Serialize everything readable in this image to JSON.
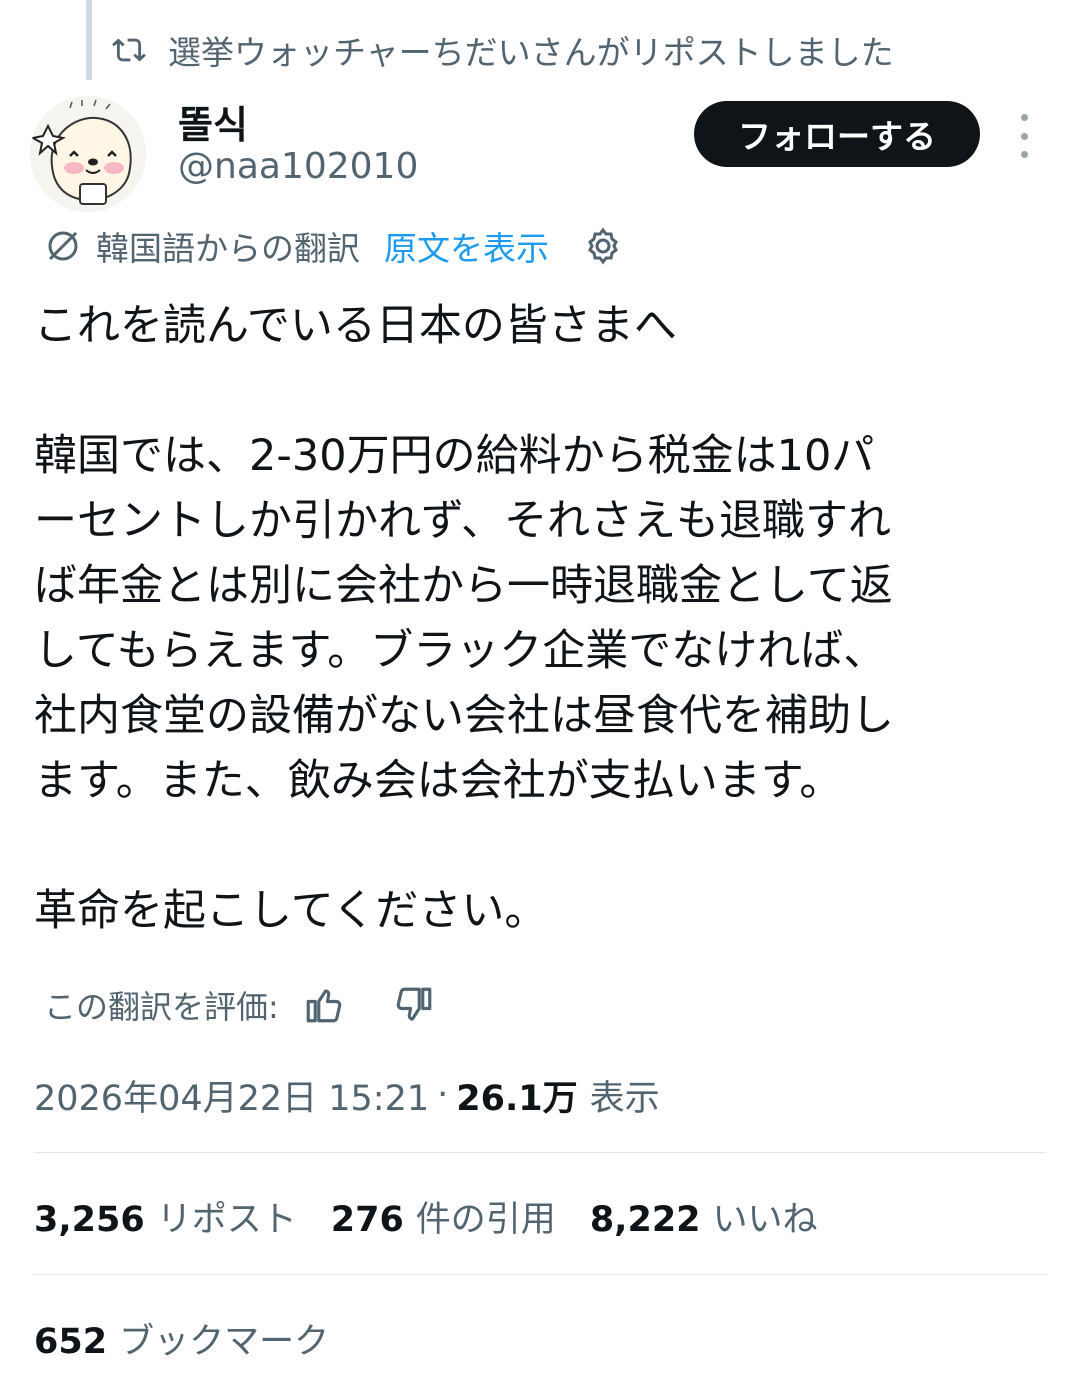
{
  "repost": {
    "icon": "repost-icon",
    "text": "選挙ウォッチャーちだいさんがリポストしました"
  },
  "author": {
    "name": "똘식",
    "handle": "@naa102010"
  },
  "follow_button": {
    "label": "フォローする"
  },
  "translation": {
    "language_label": "韓国語からの翻訳",
    "show_original_label": "原文を表示"
  },
  "tweet": {
    "line1": "これを読んでいる日本の皆さまへ",
    "paragraph2_lines": [
      "韓国では、2-30万円の給料から税金は10パ",
      "ーセントしか引かれず、それさえも退職すれ",
      "ば年金とは別に会社から一時退職金として返",
      "してもらえます。ブラック企業でなければ、",
      "社内食堂の設備がない会社は昼食代を補助し",
      "ます。また、飲み会は会社が支払います。"
    ],
    "line3": "革命を起こしてください。"
  },
  "rating": {
    "label": "この翻訳を評価:"
  },
  "meta": {
    "timestamp": "2026年04月22日 15:21",
    "separator": "·",
    "views_count": "26.1万",
    "views_label": "表示"
  },
  "stats": {
    "reposts": {
      "count": "3,256",
      "label": "リポスト"
    },
    "quotes": {
      "count": "276",
      "label": "件の引用"
    },
    "likes": {
      "count": "8,222",
      "label": "いいね"
    },
    "bookmarks": {
      "count": "652",
      "label": "ブックマーク"
    }
  },
  "colors": {
    "accent": "#1d9bf0",
    "text_primary": "#0f1419",
    "text_secondary": "#536471",
    "button_bg": "#0f1419"
  }
}
